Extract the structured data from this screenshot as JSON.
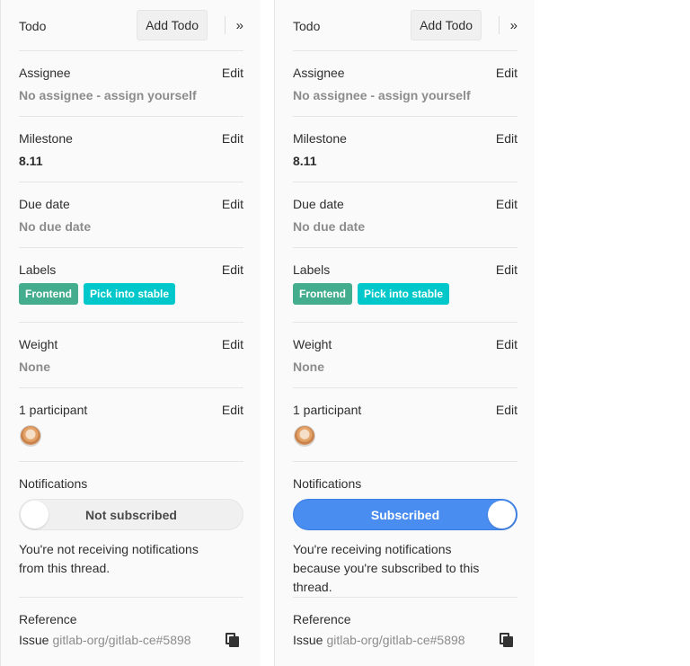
{
  "panels": [
    {
      "todo": {
        "title": "Todo",
        "add_label": "Add Todo",
        "collapse_icon": "»"
      },
      "assignee": {
        "title": "Assignee",
        "edit": "Edit",
        "value": "No assignee - assign yourself"
      },
      "milestone": {
        "title": "Milestone",
        "edit": "Edit",
        "value": "8.11"
      },
      "due_date": {
        "title": "Due date",
        "edit": "Edit",
        "value": "No due date"
      },
      "labels": {
        "title": "Labels",
        "edit": "Edit",
        "items": [
          {
            "text": "Frontend",
            "color": "#44ad8e"
          },
          {
            "text": "Pick into stable",
            "color": "#00c8ca"
          }
        ]
      },
      "weight": {
        "title": "Weight",
        "edit": "Edit",
        "value": "None"
      },
      "participants": {
        "title": "1 participant",
        "edit": "Edit"
      },
      "notifications": {
        "title": "Notifications",
        "toggle_label": "Not subscribed",
        "subscribed": false,
        "description": "You're not receiving notifications from this thread."
      },
      "reference": {
        "title": "Reference",
        "prefix": "Issue",
        "path": "gitlab-org/gitlab-ce#5898"
      }
    },
    {
      "todo": {
        "title": "Todo",
        "add_label": "Add Todo",
        "collapse_icon": "»"
      },
      "assignee": {
        "title": "Assignee",
        "edit": "Edit",
        "value": "No assignee - assign yourself"
      },
      "milestone": {
        "title": "Milestone",
        "edit": "Edit",
        "value": "8.11"
      },
      "due_date": {
        "title": "Due date",
        "edit": "Edit",
        "value": "No due date"
      },
      "labels": {
        "title": "Labels",
        "edit": "Edit",
        "items": [
          {
            "text": "Frontend",
            "color": "#44ad8e"
          },
          {
            "text": "Pick into stable",
            "color": "#00c8ca"
          }
        ]
      },
      "weight": {
        "title": "Weight",
        "edit": "Edit",
        "value": "None"
      },
      "participants": {
        "title": "1 participant",
        "edit": "Edit"
      },
      "notifications": {
        "title": "Notifications",
        "toggle_label": "Subscribed",
        "subscribed": true,
        "description": "You're receiving notifications because you're subscribed to this thread."
      },
      "reference": {
        "title": "Reference",
        "prefix": "Issue",
        "path": "gitlab-org/gitlab-ce#5898"
      }
    }
  ],
  "icons": {
    "copy": "clipboard-icon",
    "collapse": "double-chevron-right-icon"
  },
  "colors": {
    "toggle_on": "#4a8df0",
    "toggle_off": "#f0f0f0"
  }
}
